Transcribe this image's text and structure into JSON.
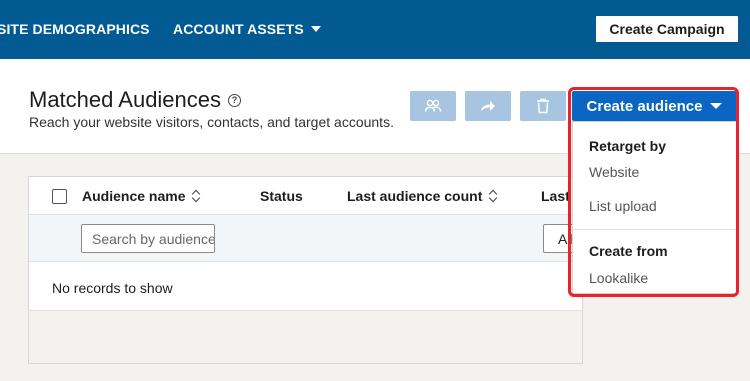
{
  "nav": {
    "website_demographics": "SITE DEMOGRAPHICS",
    "account_assets": "ACCOUNT ASSETS",
    "create_campaign": "Create Campaign"
  },
  "header": {
    "title": "Matched Audiences",
    "help_glyph": "?",
    "subtitle": "Reach your website visitors, contacts, and target accounts.",
    "create_audience": "Create audience"
  },
  "table": {
    "columns": [
      "Audience name",
      "Status",
      "Last audience count",
      "Last"
    ],
    "search_placeholder": "Search by audience name",
    "filter_value": "All",
    "empty_message": "No records to show"
  },
  "dropdown": {
    "retarget_heading": "Retarget by",
    "retarget_items": [
      "Website",
      "List upload"
    ],
    "create_heading": "Create from",
    "create_items": [
      "Lookalike"
    ]
  },
  "colors": {
    "nav_bg": "#015a91",
    "primary_button": "#0a66c2",
    "disabled_button": "#a7c5e0",
    "highlight": "#e8232b"
  }
}
